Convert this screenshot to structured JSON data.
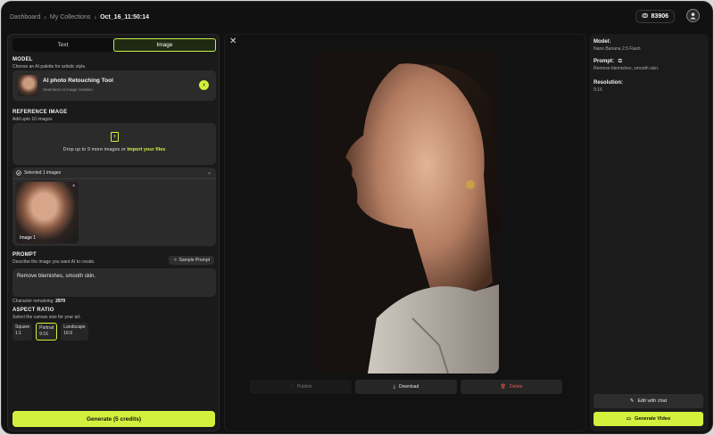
{
  "breadcrumb": {
    "items": [
      "Dashboard",
      "My Collections"
    ],
    "current": "Oct_16_11:50:14"
  },
  "credits": {
    "value": "83906"
  },
  "mode_tabs": [
    "Text",
    "Image"
  ],
  "model": {
    "heading": "MODEL",
    "subheading": "Choose an AI palette for artistic style.",
    "name": "AI photo Retouching Tool",
    "description": "Seamless AI image creation."
  },
  "reference": {
    "heading": "REFERENCE IMAGE",
    "subheading": "Add upto 10 images",
    "drop_text": "Drop up to 9 more images or",
    "drop_link": "import your files",
    "selected_label": "Selected 1 images",
    "thumb_label": "Image 1"
  },
  "prompt": {
    "heading": "PROMPT",
    "subheading": "Describe the image you want AI to create.",
    "sample_button": "Sample Prompt",
    "value": "Remove blemishes, smooth skin.",
    "char_label": "Character remaining:",
    "char_value": "2970"
  },
  "aspect": {
    "heading": "ASPECT RATIO",
    "subheading": "Select the canvas size for your art.",
    "options": [
      {
        "name": "Square",
        "ratio": "1:1"
      },
      {
        "name": "Portrait",
        "ratio": "9:16"
      },
      {
        "name": "Landscape",
        "ratio": "16:9"
      }
    ]
  },
  "generate_label": "Generate (5 credits)",
  "actions": {
    "publish": "Publish",
    "download": "Download",
    "delete": "Delete"
  },
  "details": {
    "model_label": "Model:",
    "model_value": "Nano Banana 2.5 Flash",
    "prompt_label": "Prompt:",
    "prompt_value": "Remove blemishes, smooth skin.",
    "resolution_label": "Resolution:",
    "resolution_value": "9:16"
  },
  "side_buttons": {
    "chat": "Edit with chat",
    "video": "Generate Video"
  },
  "colors": {
    "accent": "#d2f03c",
    "danger": "#e25b4b",
    "bg": "#111111"
  }
}
